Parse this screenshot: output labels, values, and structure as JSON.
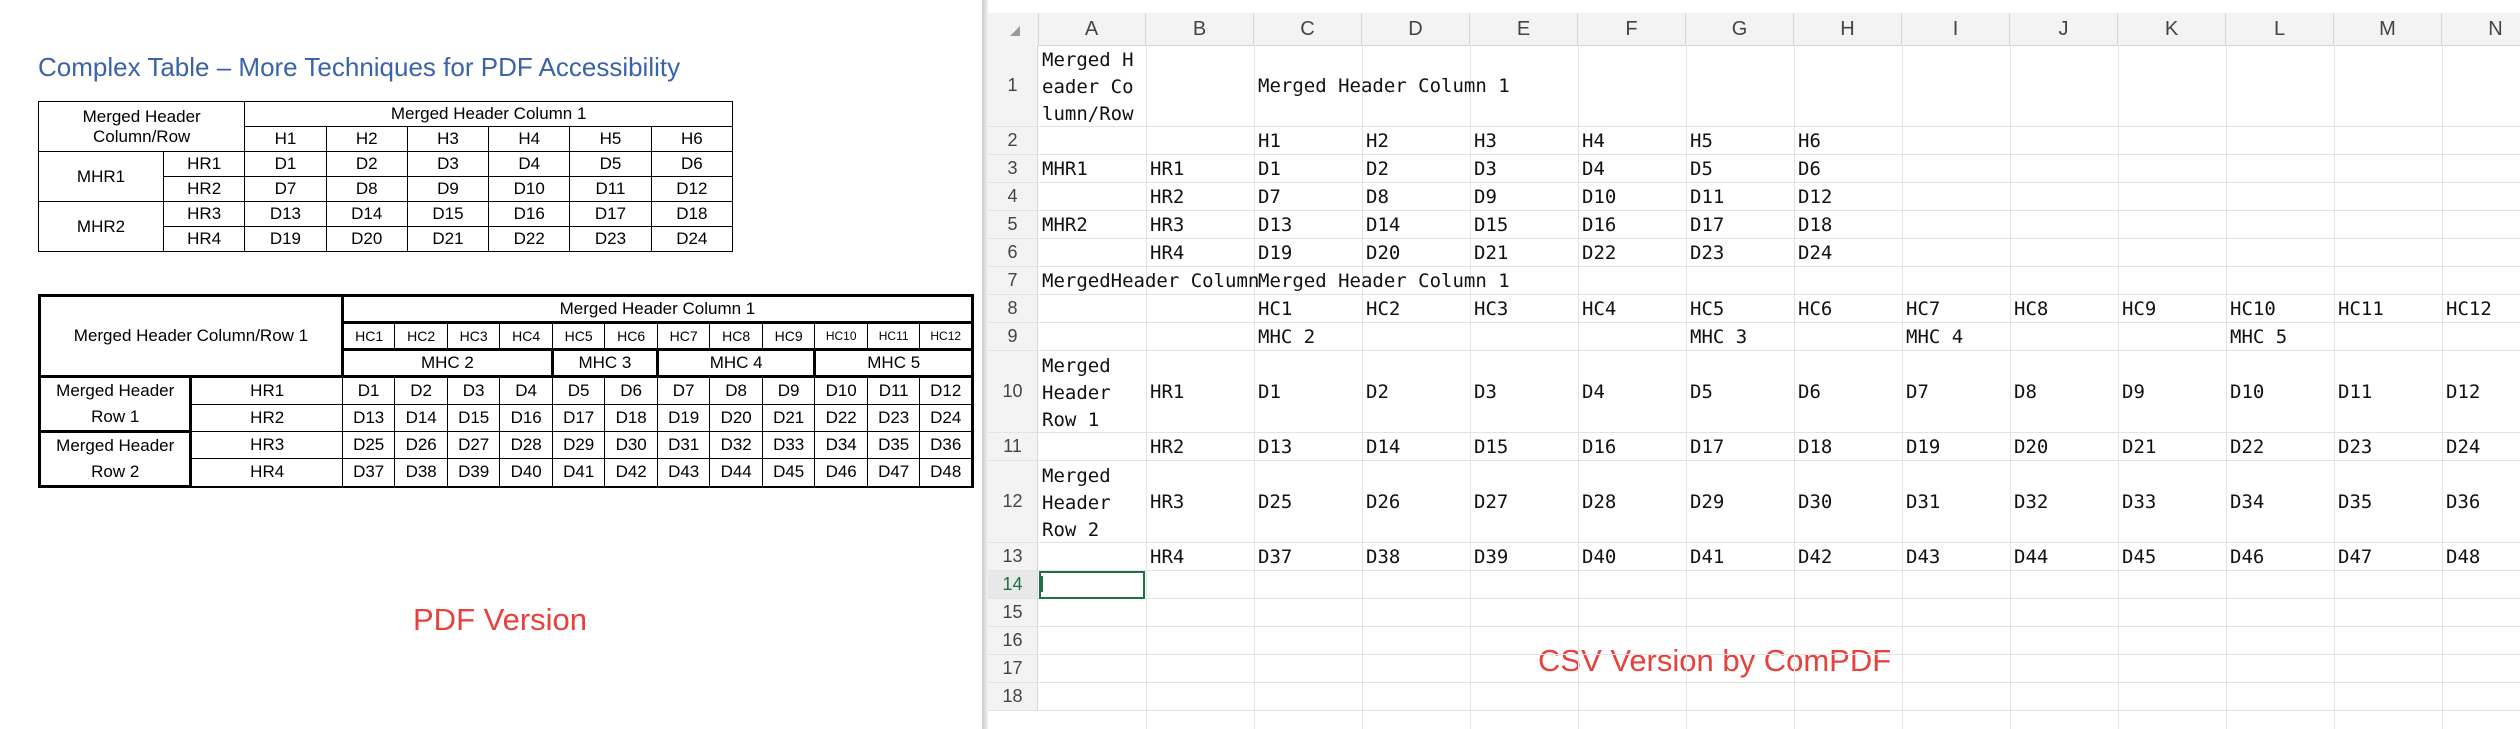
{
  "pdf": {
    "title": "Complex Table – More Techniques for PDF Accessibility",
    "label": "PDF Version",
    "table1": {
      "corner": "Merged Header Column/Row",
      "top_header": "Merged Header Column 1",
      "sub_headers": [
        "H1",
        "H2",
        "H3",
        "H4",
        "H5",
        "H6"
      ],
      "groups": [
        {
          "name": "MHR1",
          "rows": [
            {
              "rh": "HR1",
              "cells": [
                "D1",
                "D2",
                "D3",
                "D4",
                "D5",
                "D6"
              ]
            },
            {
              "rh": "HR2",
              "cells": [
                "D7",
                "D8",
                "D9",
                "D10",
                "D11",
                "D12"
              ]
            }
          ]
        },
        {
          "name": "MHR2",
          "rows": [
            {
              "rh": "HR3",
              "cells": [
                "D13",
                "D14",
                "D15",
                "D16",
                "D17",
                "D18"
              ]
            },
            {
              "rh": "HR4",
              "cells": [
                "D19",
                "D20",
                "D21",
                "D22",
                "D23",
                "D24"
              ]
            }
          ]
        }
      ]
    },
    "table2": {
      "corner": "Merged Header Column/Row 1",
      "top_header": "Merged Header Column 1",
      "sub_headers": [
        "HC1",
        "HC2",
        "HC3",
        "HC4",
        "HC5",
        "HC6",
        "HC7",
        "HC8",
        "HC9",
        "HC10",
        "HC11",
        "HC12"
      ],
      "group_headers": [
        {
          "name": "MHC 2",
          "span": 4
        },
        {
          "name": "MHC 3",
          "span": 2
        },
        {
          "name": "MHC 4",
          "span": 3
        },
        {
          "name": "MHC 5",
          "span": 3
        }
      ],
      "groups": [
        {
          "name": "Merged Header Row 1",
          "rows": [
            {
              "rh": "HR1",
              "cells": [
                "D1",
                "D2",
                "D3",
                "D4",
                "D5",
                "D6",
                "D7",
                "D8",
                "D9",
                "D10",
                "D11",
                "D12"
              ]
            },
            {
              "rh": "HR2",
              "cells": [
                "D13",
                "D14",
                "D15",
                "D16",
                "D17",
                "D18",
                "D19",
                "D20",
                "D21",
                "D22",
                "D23",
                "D24"
              ]
            }
          ]
        },
        {
          "name": "Merged Header Row 2",
          "rows": [
            {
              "rh": "HR3",
              "cells": [
                "D25",
                "D26",
                "D27",
                "D28",
                "D29",
                "D30",
                "D31",
                "D32",
                "D33",
                "D34",
                "D35",
                "D36"
              ]
            },
            {
              "rh": "HR4",
              "cells": [
                "D37",
                "D38",
                "D39",
                "D40",
                "D41",
                "D42",
                "D43",
                "D44",
                "D45",
                "D46",
                "D47",
                "D48"
              ]
            }
          ]
        }
      ]
    }
  },
  "sheet": {
    "label": "CSV Version by ComPDF",
    "columns": [
      "A",
      "B",
      "C",
      "D",
      "E",
      "F",
      "G",
      "H",
      "I",
      "J",
      "K",
      "L",
      "M",
      "N"
    ],
    "row_numbers": [
      "1",
      "2",
      "3",
      "4",
      "5",
      "6",
      "7",
      "8",
      "9",
      "10",
      "11",
      "12",
      "13",
      "14",
      "15",
      "16",
      "17",
      "18"
    ],
    "active_row": "14",
    "cells": {
      "1": {
        "A": "Merged Header Column/Row",
        "C": "Merged Header Column 1"
      },
      "2": {
        "C": "H1",
        "D": "H2",
        "E": "H3",
        "F": "H4",
        "G": "H5",
        "H": "H6"
      },
      "3": {
        "A": "MHR1",
        "B": "HR1",
        "C": "D1",
        "D": "D2",
        "E": "D3",
        "F": "D4",
        "G": "D5",
        "H": "D6"
      },
      "4": {
        "B": "HR2",
        "C": "D7",
        "D": "D8",
        "E": "D9",
        "F": "D10",
        "G": "D11",
        "H": "D12"
      },
      "5": {
        "A": "MHR2",
        "B": "HR3",
        "C": "D13",
        "D": "D14",
        "E": "D15",
        "F": "D16",
        "G": "D17",
        "H": "D18"
      },
      "6": {
        "B": "HR4",
        "C": "D19",
        "D": "D20",
        "E": "D21",
        "F": "D22",
        "G": "D23",
        "H": "D24"
      },
      "7": {
        "A": "MergedHeader Column",
        "C": "Merged Header Column 1"
      },
      "8": {
        "C": "HC1",
        "D": "HC2",
        "E": "HC3",
        "F": "HC4",
        "G": "HC5",
        "H": "HC6",
        "I": "HC7",
        "J": "HC8",
        "K": "HC9",
        "L": "HC10",
        "M": "HC11",
        "N": "HC12"
      },
      "9": {
        "C": "MHC 2",
        "G": "MHC 3",
        "I": "MHC 4",
        "L": "MHC 5"
      },
      "10": {
        "A": "Merged Header Row 1",
        "B": "HR1",
        "C": "D1",
        "D": "D2",
        "E": "D3",
        "F": "D4",
        "G": "D5",
        "H": "D6",
        "I": "D7",
        "J": "D8",
        "K": "D9",
        "L": "D10",
        "M": "D11",
        "N": "D12"
      },
      "11": {
        "B": "HR2",
        "C": "D13",
        "D": "D14",
        "E": "D15",
        "F": "D16",
        "G": "D17",
        "H": "D18",
        "I": "D19",
        "J": "D20",
        "K": "D21",
        "L": "D22",
        "M": "D23",
        "N": "D24"
      },
      "12": {
        "A": "Merged Header Row 2",
        "B": "HR3",
        "C": "D25",
        "D": "D26",
        "E": "D27",
        "F": "D28",
        "G": "D29",
        "H": "D30",
        "I": "D31",
        "J": "D32",
        "K": "D33",
        "L": "D34",
        "M": "D35",
        "N": "D36"
      },
      "13": {
        "B": "HR4",
        "C": "D37",
        "D": "D38",
        "E": "D39",
        "F": "D40",
        "G": "D41",
        "H": "D42",
        "I": "D43",
        "J": "D44",
        "K": "D45",
        "L": "D46",
        "M": "D47",
        "N": "D48"
      }
    }
  }
}
